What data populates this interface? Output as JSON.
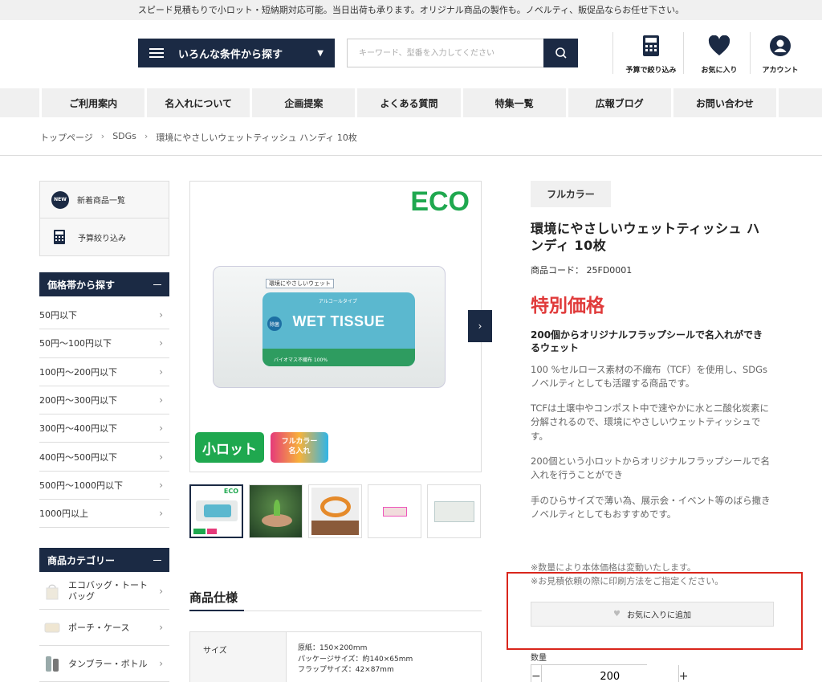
{
  "topbar": {
    "text": "スピード見積もりで小ロット・短納期対応可能。当日出荷も承ります。オリジナル商品の製作も。ノベルティ、販促品ならお任せ下さい。"
  },
  "header": {
    "condition_button": "いろんな条件から探す",
    "search_placeholder": "キーワード、型番を入力してください",
    "icons": {
      "budget": "予算で絞り込み",
      "favorite": "お気に入り",
      "account": "アカウント"
    }
  },
  "nav": [
    "ご利用案内",
    "名入れについて",
    "企画提案",
    "よくある質問",
    "特集一覧",
    "広報ブログ",
    "お問い合わせ"
  ],
  "breadcrumb": [
    "トップページ",
    "SDGs",
    "環境にやさしいウェットティッシュ ハンディ 10枚"
  ],
  "sidebar": {
    "links": {
      "new_badge": "NEW",
      "new_items": "新着商品一覧",
      "budget": "予算絞り込み"
    },
    "price_heading": "価格帯から探す",
    "price_items": [
      "50円以下",
      "50円〜100円以下",
      "100円〜200円以下",
      "200円〜300円以下",
      "300円〜400円以下",
      "400円〜500円以下",
      "500円〜1000円以下",
      "1000円以上"
    ],
    "category_heading": "商品カテゴリー",
    "categories": [
      "エコバッグ・トートバッグ",
      "ポーチ・ケース",
      "タンブラー・ボトル"
    ]
  },
  "product_image": {
    "eco": "ECO",
    "label_top": "環境にやさしいウェット",
    "label_sub": "アルコールタイプ",
    "label_main": "WET TISSUE",
    "label_badge": "除菌",
    "label_bottom": "バイオマス不織布 100%",
    "badge_lot": "小ロット",
    "badge_full_1": "フルカラー",
    "badge_full_2": "名入れ",
    "thumb_eco": "ECO"
  },
  "spec": {
    "title": "商品仕様",
    "key": "サイズ",
    "values": [
      "原紙：150×200mm",
      "パッケージサイズ：約140×65mm",
      "フラップサイズ：42×87mm"
    ]
  },
  "product": {
    "tag": "フルカラー",
    "title": "環境にやさしいウェットティッシュ ハンディ 10枚",
    "code": "商品コード： 25FD0001",
    "special": "特別価格",
    "lead": "200個からオリジナルフラップシールで名入れができるウェット",
    "desc": [
      "100 %セルロース素材の不織布（TCF）を使用し、SDGsノベルティとしても活躍する商品です。",
      "TCFは土壌中やコンポスト中で速やかに水と二酸化炭素に分解されるので、環境にやさしいウェットティッシュです。",
      "200個という小ロットからオリジナルフラップシールで名入れを行うことができ",
      "手のひらサイズで薄い為、展示会・イベント等のばら撒きノベルティとしてもおすすめです。"
    ],
    "notes": [
      "※数量により本体価格は変動いたします。",
      "※お見積依頼の際に印刷方法をご指定ください。"
    ],
    "favorite_button": "お気に入りに追加",
    "quantity_label": "数量",
    "quantity": "200",
    "minus": "−",
    "plus": "+"
  },
  "colors": {
    "navy": "#1b2a44",
    "accent_red": "#e03a3a",
    "eco_green": "#1fa84f"
  }
}
